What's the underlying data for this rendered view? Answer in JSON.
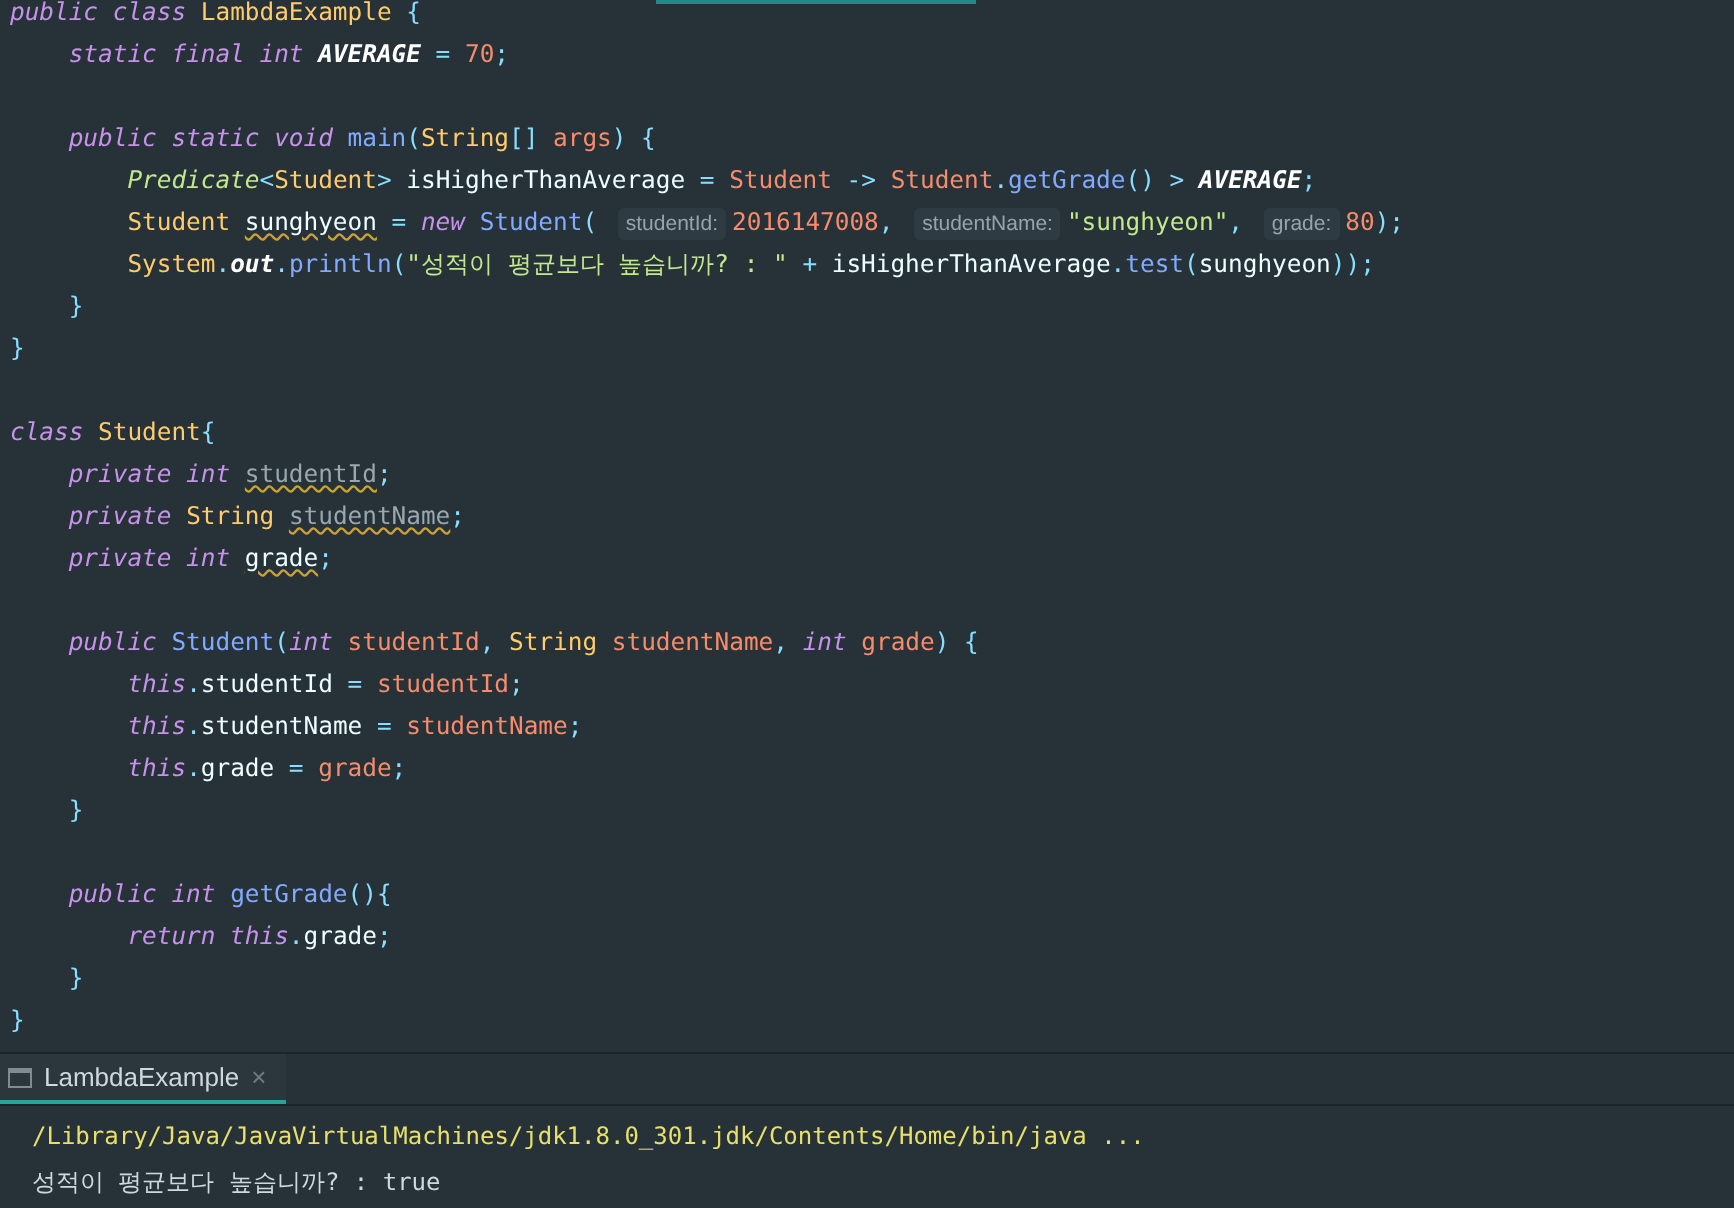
{
  "editor": {
    "lines": [
      {
        "tokens": [
          {
            "t": "public class ",
            "kind": "kw"
          },
          {
            "t": "LambdaExample ",
            "kind": "type"
          },
          {
            "t": "{",
            "kind": "punct"
          }
        ]
      },
      {
        "tokens": [
          {
            "t": "    static final int ",
            "kind": "kw"
          },
          {
            "t": "AVERAGE",
            "kind": "const"
          },
          {
            "t": " = ",
            "kind": "punct"
          },
          {
            "t": "70",
            "kind": "num"
          },
          {
            "t": ";",
            "kind": "punct"
          }
        ]
      },
      {
        "kind": "blank"
      },
      {
        "tokens": [
          {
            "t": "    public static void ",
            "kind": "kw"
          },
          {
            "t": "main",
            "kind": "method"
          },
          {
            "t": "(",
            "kind": "punct"
          },
          {
            "t": "String",
            "kind": "type"
          },
          {
            "t": "[] ",
            "kind": "punct"
          },
          {
            "t": "args",
            "kind": "var"
          },
          {
            "t": ") {",
            "kind": "punct"
          }
        ]
      },
      {
        "tokens": [
          {
            "t": "        Predicate",
            "kind": "iface"
          },
          {
            "t": "<",
            "kind": "punct"
          },
          {
            "t": "Student",
            "kind": "type"
          },
          {
            "t": "> ",
            "kind": "punct"
          },
          {
            "t": "isHigherThanAverage ",
            "kind": "plain"
          },
          {
            "t": "= ",
            "kind": "punct"
          },
          {
            "t": "Student ",
            "kind": "var"
          },
          {
            "t": "-> ",
            "kind": "punct"
          },
          {
            "t": "Student",
            "kind": "var"
          },
          {
            "t": ".",
            "kind": "punct"
          },
          {
            "t": "getGrade",
            "kind": "method"
          },
          {
            "t": "() > ",
            "kind": "punct"
          },
          {
            "t": "AVERAGE",
            "kind": "const"
          },
          {
            "t": ";",
            "kind": "punct"
          }
        ]
      },
      {
        "tokens": [
          {
            "t": "        Student ",
            "kind": "type"
          },
          {
            "t": "sunghyeon",
            "kind": "warn"
          },
          {
            "t": " = ",
            "kind": "punct"
          },
          {
            "t": "new ",
            "kind": "kw"
          },
          {
            "t": "Student",
            "kind": "method"
          },
          {
            "t": "( ",
            "kind": "punct"
          },
          {
            "t": "studentId:",
            "kind": "hint"
          },
          {
            "t": "2016147008",
            "kind": "num"
          },
          {
            "t": ", ",
            "kind": "punct"
          },
          {
            "t": "studentName:",
            "kind": "hint"
          },
          {
            "t": "\"sunghyeon\"",
            "kind": "str"
          },
          {
            "t": ", ",
            "kind": "punct"
          },
          {
            "t": "grade:",
            "kind": "hint"
          },
          {
            "t": "80",
            "kind": "num"
          },
          {
            "t": ");",
            "kind": "punct"
          }
        ]
      },
      {
        "tokens": [
          {
            "t": "        System",
            "kind": "type"
          },
          {
            "t": ".",
            "kind": "punct"
          },
          {
            "t": "out",
            "kind": "const"
          },
          {
            "t": ".",
            "kind": "punct"
          },
          {
            "t": "println",
            "kind": "method"
          },
          {
            "t": "(",
            "kind": "punct"
          },
          {
            "t": "\"성적이 평균보다 높습니까? : \"",
            "kind": "str"
          },
          {
            "t": " + ",
            "kind": "punct"
          },
          {
            "t": "isHigherThanAverage",
            "kind": "plain"
          },
          {
            "t": ".",
            "kind": "punct"
          },
          {
            "t": "test",
            "kind": "method"
          },
          {
            "t": "(",
            "kind": "punct"
          },
          {
            "t": "sunghyeon",
            "kind": "plain"
          },
          {
            "t": "));",
            "kind": "punct"
          }
        ]
      },
      {
        "tokens": [
          {
            "t": "    }",
            "kind": "punct"
          }
        ]
      },
      {
        "tokens": [
          {
            "t": "}",
            "kind": "punct"
          }
        ]
      },
      {
        "kind": "blank"
      },
      {
        "tokens": [
          {
            "t": "class ",
            "kind": "kw"
          },
          {
            "t": "Student",
            "kind": "type"
          },
          {
            "t": "{",
            "kind": "punct"
          }
        ]
      },
      {
        "tokens": [
          {
            "t": "    private int ",
            "kind": "kw"
          },
          {
            "t": "studentId",
            "kind": "unused"
          },
          {
            "t": ";",
            "kind": "punct"
          }
        ]
      },
      {
        "tokens": [
          {
            "t": "    private ",
            "kind": "kw"
          },
          {
            "t": "String ",
            "kind": "type"
          },
          {
            "t": "studentName",
            "kind": "unused"
          },
          {
            "t": ";",
            "kind": "punct"
          }
        ]
      },
      {
        "tokens": [
          {
            "t": "    private int ",
            "kind": "kw"
          },
          {
            "t": "grade",
            "kind": "warn"
          },
          {
            "t": ";",
            "kind": "punct"
          }
        ]
      },
      {
        "kind": "blank"
      },
      {
        "tokens": [
          {
            "t": "    public ",
            "kind": "kw"
          },
          {
            "t": "Student",
            "kind": "method"
          },
          {
            "t": "(",
            "kind": "punct"
          },
          {
            "t": "int ",
            "kind": "kw"
          },
          {
            "t": "studentId",
            "kind": "var"
          },
          {
            "t": ", ",
            "kind": "punct"
          },
          {
            "t": "String ",
            "kind": "type"
          },
          {
            "t": "studentName",
            "kind": "var"
          },
          {
            "t": ", ",
            "kind": "punct"
          },
          {
            "t": "int ",
            "kind": "kw"
          },
          {
            "t": "grade",
            "kind": "var"
          },
          {
            "t": ") {",
            "kind": "punct"
          }
        ]
      },
      {
        "tokens": [
          {
            "t": "        this",
            "kind": "kw"
          },
          {
            "t": ".",
            "kind": "punct"
          },
          {
            "t": "studentId",
            "kind": "plain"
          },
          {
            "t": " = ",
            "kind": "punct"
          },
          {
            "t": "studentId",
            "kind": "var"
          },
          {
            "t": ";",
            "kind": "punct"
          }
        ]
      },
      {
        "tokens": [
          {
            "t": "        this",
            "kind": "kw"
          },
          {
            "t": ".",
            "kind": "punct"
          },
          {
            "t": "studentName",
            "kind": "plain"
          },
          {
            "t": " = ",
            "kind": "punct"
          },
          {
            "t": "studentName",
            "kind": "var"
          },
          {
            "t": ";",
            "kind": "punct"
          }
        ]
      },
      {
        "tokens": [
          {
            "t": "        this",
            "kind": "kw"
          },
          {
            "t": ".",
            "kind": "punct"
          },
          {
            "t": "grade",
            "kind": "plain"
          },
          {
            "t": " = ",
            "kind": "punct"
          },
          {
            "t": "grade",
            "kind": "var"
          },
          {
            "t": ";",
            "kind": "punct"
          }
        ]
      },
      {
        "tokens": [
          {
            "t": "    }",
            "kind": "punct"
          }
        ]
      },
      {
        "kind": "blank"
      },
      {
        "tokens": [
          {
            "t": "    public int ",
            "kind": "kw"
          },
          {
            "t": "getGrade",
            "kind": "method"
          },
          {
            "t": "(){",
            "kind": "punct"
          }
        ]
      },
      {
        "tokens": [
          {
            "t": "        return this",
            "kind": "kw"
          },
          {
            "t": ".",
            "kind": "punct"
          },
          {
            "t": "grade",
            "kind": "plain"
          },
          {
            "t": ";",
            "kind": "punct"
          }
        ]
      },
      {
        "tokens": [
          {
            "t": "    }",
            "kind": "punct"
          }
        ]
      },
      {
        "tokens": [
          {
            "t": "}",
            "kind": "punct"
          }
        ]
      }
    ]
  },
  "run_panel": {
    "tabs": [
      {
        "label": "LambdaExample",
        "close": "×",
        "selected": true
      }
    ],
    "output": [
      {
        "text": "/Library/Java/JavaVirtualMachines/jdk1.8.0_301.jdk/Contents/Home/bin/java ...",
        "kind": "command"
      },
      {
        "text": "성적이 평균보다 높습니까? : true",
        "kind": "stdout"
      }
    ]
  }
}
